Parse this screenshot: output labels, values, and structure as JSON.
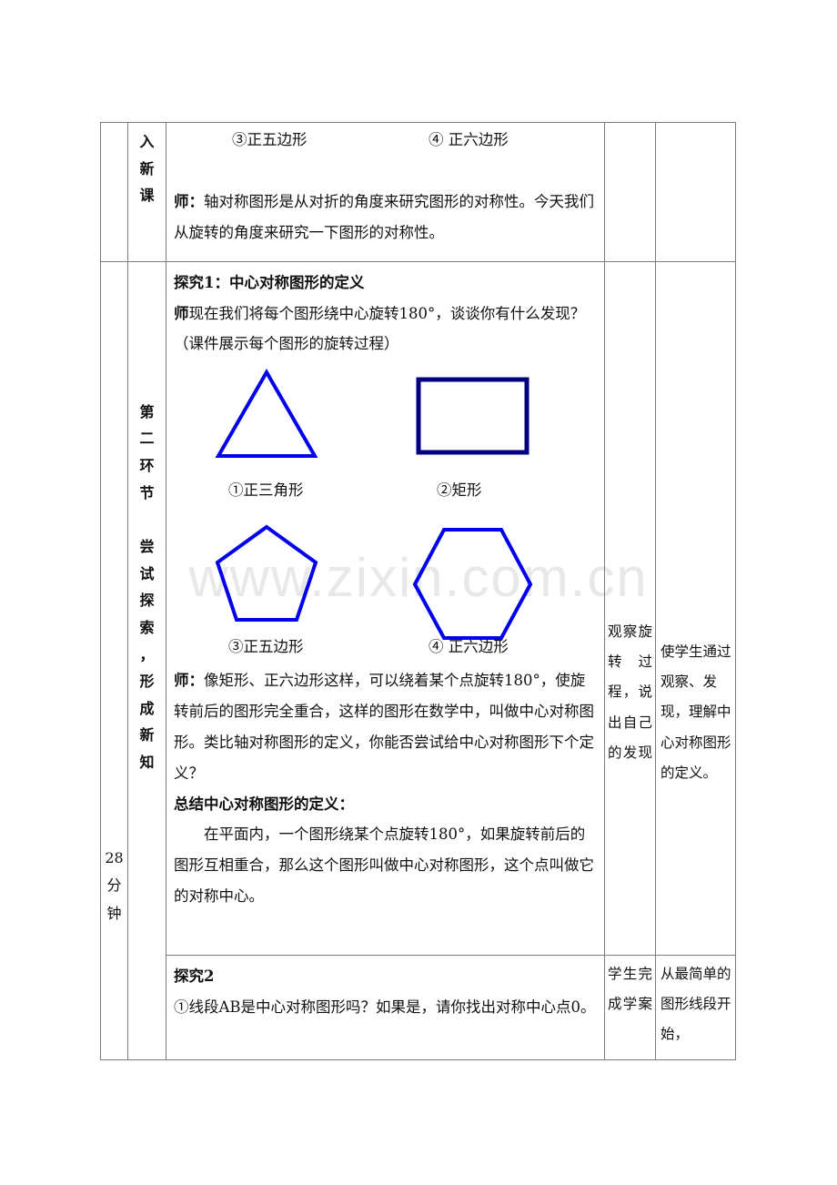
{
  "document": {
    "type": "lesson-plan-table",
    "watermark": "www.zixin.com.cn",
    "colors": {
      "shape_blue": "#0000ee",
      "shape_navy": "#000080",
      "table_border": "#7d7d7d",
      "watermark": "#e8e8e8"
    }
  },
  "row_intro": {
    "stage_chars": [
      "入",
      "新",
      "课"
    ],
    "shape_label_3": "③正五边形",
    "shape_label_4": "④ 正六边形",
    "teacher_line_lead": "师：",
    "teacher_line_text": "轴对称图形是从对折的角度来研究图形的对称性。今天我们从旋转的角度来研究一下图形的对称性。"
  },
  "row_explore": {
    "time": {
      "number": "28",
      "chars": [
        "分",
        "钟"
      ]
    },
    "stage": {
      "chars_top": [
        "第",
        "二",
        "环",
        "节"
      ],
      "chars_bottom": [
        "尝",
        "试",
        "探",
        "索",
        "，",
        "形",
        "成",
        "新",
        "知"
      ]
    },
    "heading1": "探究1：中心对称图形的定义",
    "q1_lead": "师",
    "q1_text": "现在我们将每个图形绕中心旋转180°，谈谈你有什么发现？（课件展示每个图形的旋转过程）",
    "shapes": [
      {
        "name": "triangle",
        "caption": "①正三角形",
        "color": "#0000ee"
      },
      {
        "name": "rectangle",
        "caption": "②矩形",
        "color": "#000080"
      },
      {
        "name": "pentagon",
        "caption": "③正五边形",
        "color": "#0000ee"
      },
      {
        "name": "hexagon",
        "caption": "④ 正六边形",
        "color": "#0000ee"
      }
    ],
    "p2_lead": "师：",
    "p2_text": "像矩形、正六边形这样，可以绕着某个点旋转180°，使旋转前后的图形完全重合，这样的图形在数学中，叫做中心对称图形。类比轴对称图形的定义，你能否尝试给中心对称图形下个定义？",
    "heading2": "总结中心对称图形的定义：",
    "definition": "在平面内，一个图形绕某个点旋转180°，如果旋转前后的图形互相重合，那么这个图形叫做中心对称图形，这个点叫做它的对称中心。",
    "observation_note": "观察旋转过程，说出自己的发现",
    "purpose_note": "使学生通过观察、发现，理解中心对称图形的定义。"
  },
  "row_explore2": {
    "heading": "探究2",
    "question": "①线段AB是中心对称图形吗？如果是，请你找出对称中心点0。",
    "observation_note": "学生完成学案",
    "purpose_note": "从最简单的图形线段开始，"
  }
}
